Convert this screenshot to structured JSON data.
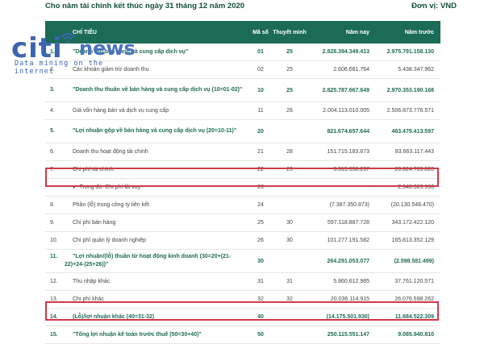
{
  "header": {
    "title": "Cho năm tài chính kết thúc ngày 31 tháng 12 năm 2020",
    "unit": "Đơn vị: VND"
  },
  "watermark": {
    "brand_a": "citi",
    "brand_b": "news",
    "tagline": "Data mining on the internet"
  },
  "columns": {
    "name": "CHỈ TIÊU",
    "ma_so": "Mã số",
    "thuyet_minh": "Thuyết minh",
    "nam_nay": "Năm nay",
    "nam_truoc": "Năm trước"
  },
  "rows": [
    {
      "stt": "1.",
      "name": "\"Doanh thu bán hàng và cung cấp dịch vụ\"",
      "ma": "01",
      "tm": "25",
      "nay": "2.828.394.349.413",
      "truoc": "2.975.791.158.130"
    },
    {
      "stt": "2.",
      "name": "Các khoản giảm trừ doanh thu",
      "ma": "02",
      "tm": "25",
      "nay": "2.606.681.764",
      "truoc": "5.438.347.962"
    },
    {
      "stt": "3.",
      "name": "\"Doanh thu thuần về bán hàng và cung cấp dịch vụ (10=01-02)\"",
      "ma": "10",
      "tm": "25",
      "nay": "2.825.787.667.649",
      "truoc": "2.970.353.190.168"
    },
    {
      "stt": "4.",
      "name": "Giá vốn hàng bán và dịch vụ cung cấp",
      "ma": "11",
      "tm": "26",
      "nay": "2.004.113.010.005",
      "truoc": "2.506.873.776.571"
    },
    {
      "stt": "5.",
      "name": "\"Lợi nhuận gộp về bán hàng và cung cấp dịch vụ (20=10-11)\"",
      "ma": "20",
      "tm": "",
      "nay": "821.674.657.644",
      "truoc": "463.479.413.597"
    },
    {
      "stt": "6.",
      "name": "Doanh thu hoạt động tài chính",
      "ma": "21",
      "tm": "28",
      "nay": "151.715.183.873",
      "truoc": "83.663.117.443"
    },
    {
      "stt": "7.",
      "name": "Chi phí tài chính",
      "ma": "22",
      "tm": "29",
      "nay": "3.315.358.257",
      "truoc": "20.624.789.820"
    },
    {
      "stt": "",
      "name": "Trong đó: Chi phí lãi vay",
      "ma": "23",
      "tm": "",
      "nay": "-",
      "truoc": "2.348.309.930"
    },
    {
      "stt": "8.",
      "name": "Phần (lỗ) trong công ty liên kết",
      "ma": "24",
      "tm": "",
      "nay": "(7.387.350.873)",
      "truoc": "(20.130.548.470)"
    },
    {
      "stt": "9.",
      "name": "Chi phí bán hàng",
      "ma": "25",
      "tm": "30",
      "nay": "597.118.887.728",
      "truoc": "343.172.422.120"
    },
    {
      "stt": "10.",
      "name": "Chi phí quản lý doanh nghiệp",
      "ma": "26",
      "tm": "30",
      "nay": "101.277.191.582",
      "truoc": "165.813.352.129"
    },
    {
      "stt": "11.",
      "name": "\"Lợi nhuận/(lỗ) thuần từ hoạt động kinh doanh (30=20+(21-22)+24-(25+26))\"",
      "ma": "30",
      "tm": "",
      "nay": "264.291.053.077",
      "truoc": "(2.598.581.499)"
    },
    {
      "stt": "12.",
      "name": "Thu nhập khác",
      "ma": "31",
      "tm": "31",
      "nay": "5.860.612.985",
      "truoc": "37.761.120.571"
    },
    {
      "stt": "13.",
      "name": "Chi phí khác",
      "ma": "32",
      "tm": "32",
      "nay": "20.036.114.915",
      "truoc": "26.076.598.262"
    },
    {
      "stt": "14.",
      "name": "(Lỗ)/lợi nhuận khác (40=31-32)",
      "ma": "40",
      "tm": "",
      "nay": "(14.175.501.930)",
      "truoc": "11.684.522.309"
    },
    {
      "stt": "15.",
      "name": "\"Tổng lợi nhuận kế toán trước thuế (50=30+40)\"",
      "ma": "50",
      "tm": "",
      "nay": "250.115.551.147",
      "truoc": "9.085.940.810"
    }
  ]
}
